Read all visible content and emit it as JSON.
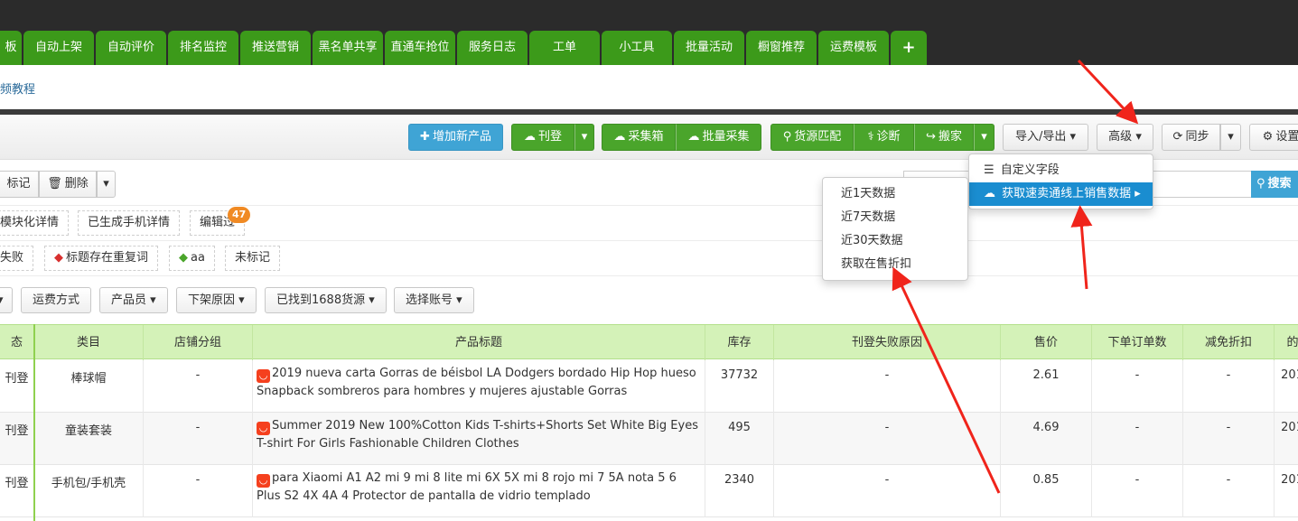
{
  "nav": {
    "tabs": [
      {
        "label": "板",
        "w": 24
      },
      {
        "label": "自动上架",
        "w": 78
      },
      {
        "label": "自动评价",
        "w": 78
      },
      {
        "label": "排名监控",
        "w": 78
      },
      {
        "label": "推送营销",
        "w": 78
      },
      {
        "label": "黑名单共享",
        "w": 78
      },
      {
        "label": "直通车抢位",
        "w": 78
      },
      {
        "label": "服务日志",
        "w": 78
      },
      {
        "label": "工单",
        "w": 78
      },
      {
        "label": "小工具",
        "w": 78
      },
      {
        "label": "批量活动",
        "w": 78
      },
      {
        "label": "橱窗推荐",
        "w": 78
      },
      {
        "label": "运费模板",
        "w": 78
      },
      {
        "label": "+",
        "w": 40
      }
    ]
  },
  "subheader": {
    "video_link": "频教程"
  },
  "toolbar": {
    "add_product": "增加新产品",
    "publish": "刊登",
    "collect_box": "采集箱",
    "batch_collect": "批量采集",
    "source_match": "货源匹配",
    "diagnose": "诊断",
    "move_store": "搬家",
    "import_export": "导入/导出",
    "advanced": "高级",
    "sync": "同步",
    "settings": "设置"
  },
  "actions": {
    "mark": "标记",
    "delete": "删除",
    "search": "搜索"
  },
  "tags_row1": {
    "modular": "模块化详情",
    "mobile": "已生成手机详情",
    "edit": "编辑过",
    "edit_count": "47"
  },
  "tags_row2": {
    "failed": "失败",
    "dup_title": "标题存在重复词",
    "aa": "aa",
    "unmarked": "未标记"
  },
  "filters": {
    "shipping": "运费方式",
    "product_person": "产品员",
    "offline_reason": "下架原因",
    "found_1688": "已找到1688货源",
    "account": "选择账号"
  },
  "table": {
    "headers": {
      "status": "态",
      "category": "类目",
      "shop_group": "店铺分组",
      "title": "产品标题",
      "stock": "库存",
      "fail_reason": "刊登失败原因",
      "price": "售价",
      "orders": "下单订单数",
      "discount": "减免折扣",
      "date": "的"
    },
    "rows": [
      {
        "status": "刊登",
        "category": "棒球帽",
        "shop_group": "-",
        "title": "2019 nueva carta Gorras de béisbol LA Dodgers bordado Hip Hop hueso Snapback sombreros para hombres y mujeres ajustable Gorras",
        "stock": "37732",
        "fail_reason": "-",
        "price": "2.61",
        "orders": "-",
        "discount": "-",
        "date": "201"
      },
      {
        "status": "刊登",
        "category": "童装套装",
        "shop_group": "-",
        "title": "Summer 2019 New 100%Cotton Kids T-shirts+Shorts Set White Big Eyes T-shirt For Girls Fashionable Children Clothes",
        "stock": "495",
        "fail_reason": "-",
        "price": "4.69",
        "orders": "-",
        "discount": "-",
        "date": "201"
      },
      {
        "status": "刊登",
        "category": "手机包/手机壳",
        "shop_group": "-",
        "title": "para Xiaomi A1 A2 mi 9 mi 8 lite mi 6X 5X mi 8 rojo mi 7 5A nota 5 6 Plus S2 4X 4A 4 Protector de pantalla de vidrio templado",
        "stock": "2340",
        "fail_reason": "-",
        "price": "0.85",
        "orders": "-",
        "discount": "-",
        "date": "201"
      }
    ]
  },
  "advanced_menu": {
    "custom_fields": "自定义字段",
    "get_sales": "获取速卖通线上销售数据"
  },
  "sales_submenu": {
    "d1": "近1天数据",
    "d7": "近7天数据",
    "d30": "近30天数据",
    "discount": "获取在售折扣"
  },
  "colors": {
    "nav_green": "#3c9a1a",
    "btn_green": "#4aa52b",
    "btn_blue": "#3fa4d5",
    "table_head": "#d4f2b8",
    "menu_active": "#1a8dd0",
    "arrow_red": "#f0241b",
    "badge": "#f08a24"
  }
}
